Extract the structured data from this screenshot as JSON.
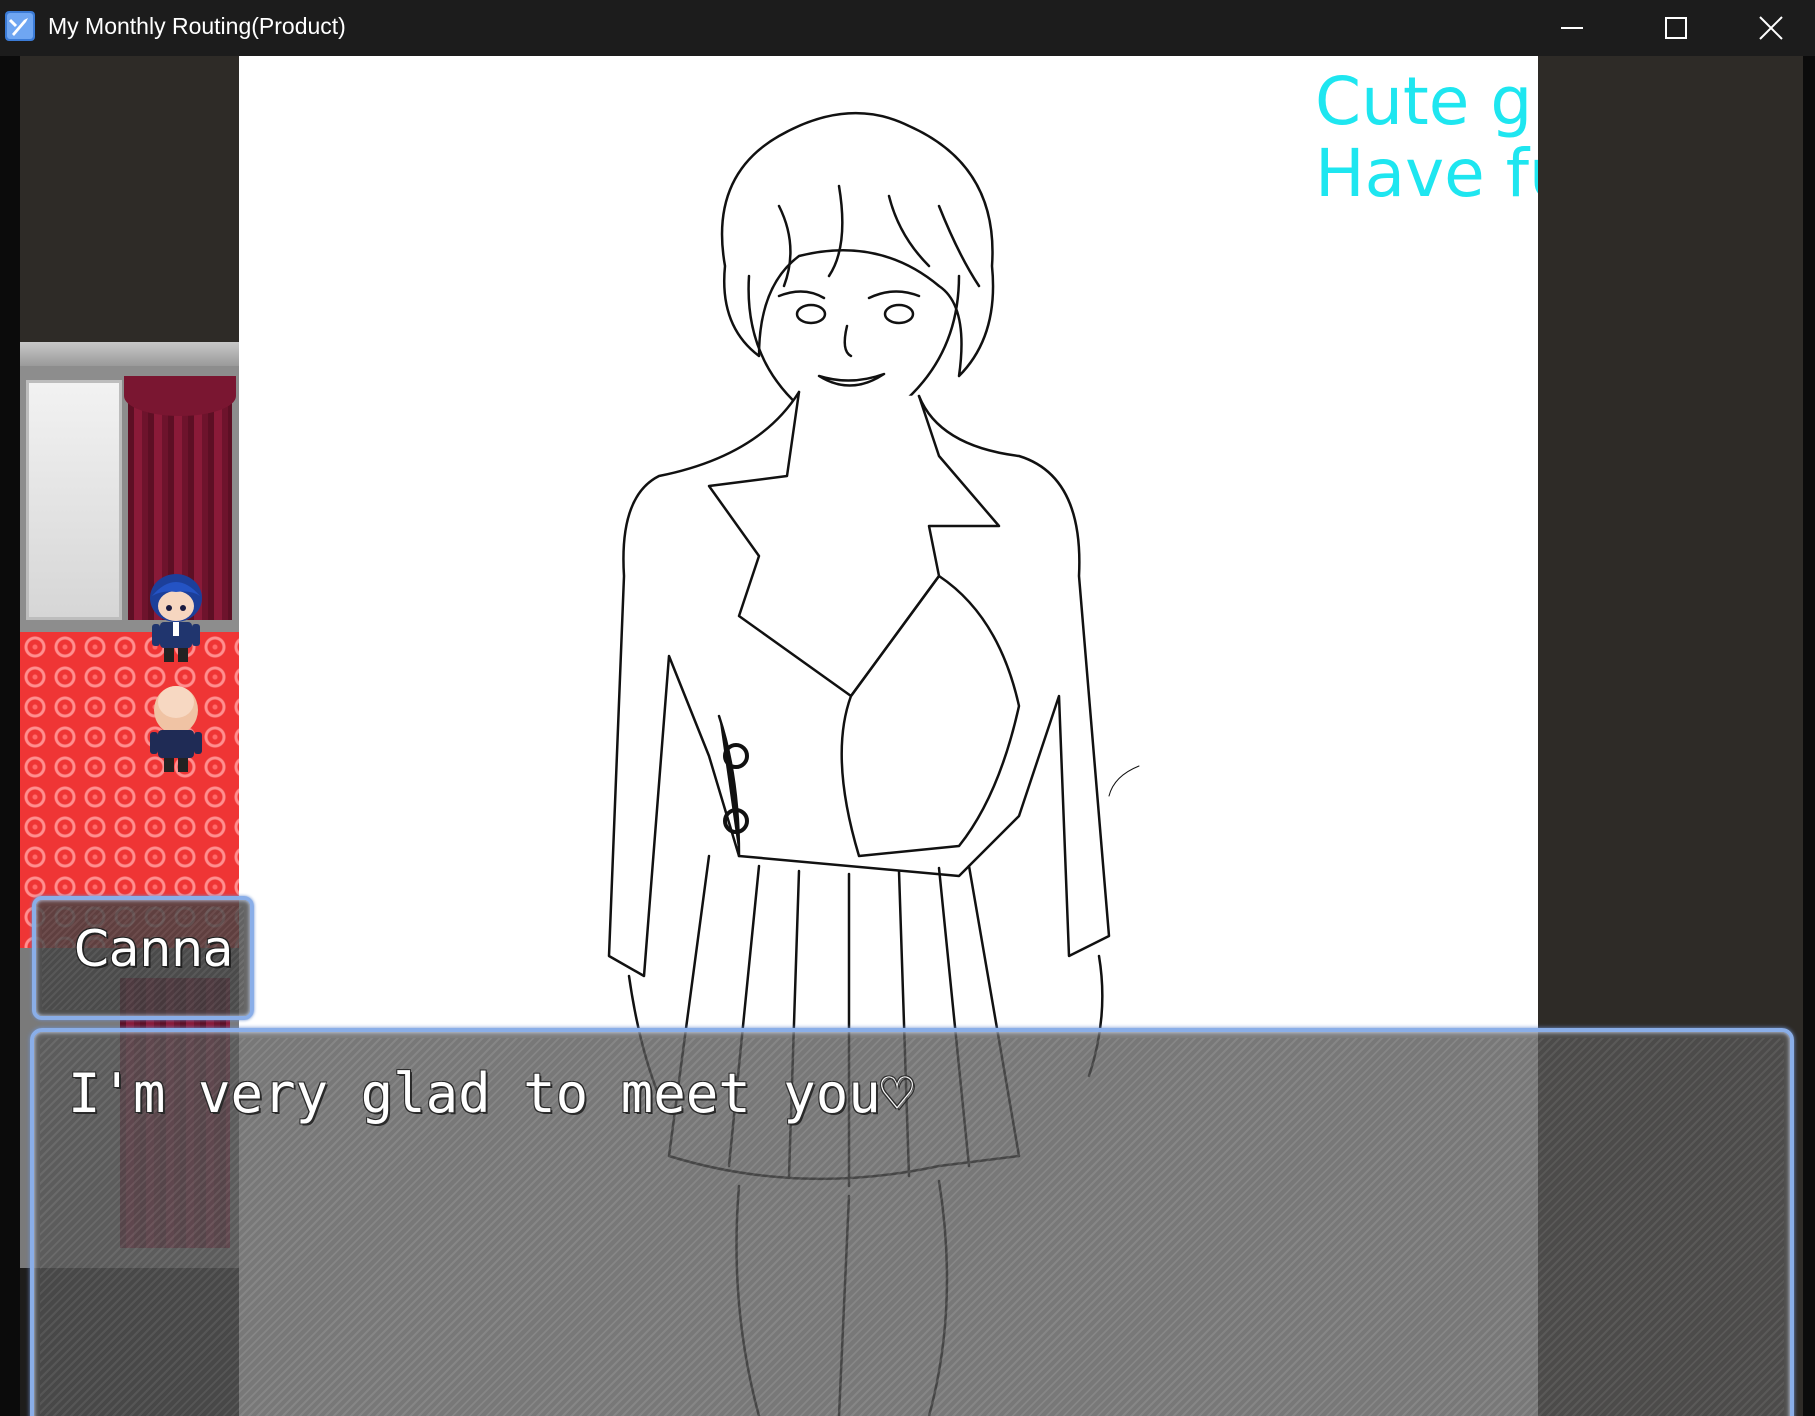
{
  "window": {
    "title": "My Monthly Routing(Product)",
    "icon": "rpg-maker-app-icon",
    "controls": {
      "minimize": "minimize-icon",
      "maximize": "maximize-icon",
      "close": "close-icon"
    }
  },
  "scene": {
    "caption_lines": [
      "Cute girl！",
      "Have fuck you soon！"
    ],
    "caption_color": "#1ee6f0",
    "map_sprites": [
      "blue-haired-boy-sprite",
      "bald-man-sprite"
    ]
  },
  "dialogue": {
    "speaker": "Canna",
    "message": "I'm very glad to meet you♡",
    "continue_indicator": "continue-arrow-icon",
    "frame_color": "#8aaee8"
  }
}
